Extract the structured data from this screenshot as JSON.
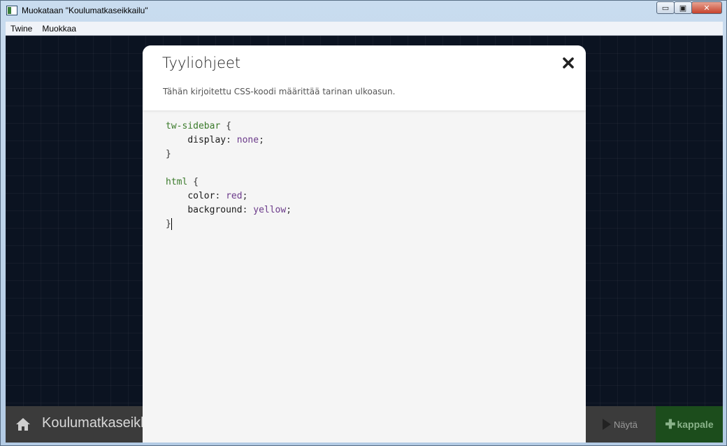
{
  "window": {
    "title": "Muokataan \"Koulumatkaseikkailu\"",
    "controls": {
      "minimize": "▭",
      "maximize": "▣",
      "close": "✕"
    }
  },
  "menu": {
    "items": [
      "Twine",
      "Muokkaa"
    ]
  },
  "bottom_bar": {
    "story_name": "Koulumatkaseikkailu",
    "view_label": "Näytä",
    "add_label": "kappale"
  },
  "dialog": {
    "title": "Tyyliohjeet",
    "description": "Tähän kirjoitettu CSS-koodi määrittää tarinan ulkoasun.",
    "close_icon": "close-icon",
    "code": {
      "rule1_selector": "tw-sidebar",
      "rule1_open": " {",
      "rule1_prop": "display",
      "rule1_value": "none",
      "rule1_close": "}",
      "rule2_selector": "html",
      "rule2_open": " {",
      "rule2_prop1": "color",
      "rule2_value1": "red",
      "rule2_prop2": "background",
      "rule2_value2": "yellow",
      "rule2_close": "}"
    }
  },
  "colors": {
    "app_background": "#0b1321",
    "add_button": "#1c4d1c",
    "selector_color": "#3a7a2a",
    "value_color": "#6b3a8a"
  }
}
